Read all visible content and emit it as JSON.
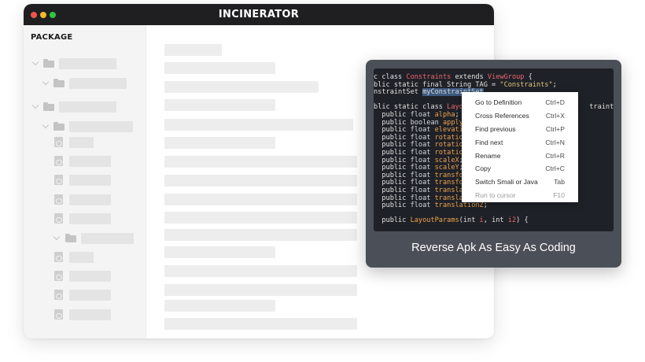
{
  "app": {
    "title": "INCINERATOR",
    "window_dots": [
      "#f0544c",
      "#f5b82d",
      "#2fc540"
    ]
  },
  "sidebar": {
    "heading": "PACKAGE"
  },
  "code": {
    "lines": [
      [
        {
          "t": "kw",
          "v": "c class "
        },
        {
          "t": "cls",
          "v": "Constraints"
        },
        {
          "t": "kw",
          "v": " extends "
        },
        {
          "t": "cls",
          "v": "ViewGroup"
        },
        {
          "t": "kw",
          "v": " {"
        }
      ],
      [
        {
          "t": "kw",
          "v": "blic static final String TAG = "
        },
        {
          "t": "str",
          "v": "\"Constraints\""
        },
        {
          "t": "kw",
          "v": ";"
        }
      ],
      [
        {
          "t": "kw",
          "v": "nstraintSet "
        },
        {
          "t": "hl",
          "v": "myConstraintSet"
        }
      ],
      [
        {
          "t": "kw",
          "v": ""
        }
      ],
      [
        {
          "t": "kw",
          "v": "blic static class "
        },
        {
          "t": "cls",
          "v": "Layou"
        },
        {
          "t": "kw",
          "v": "                              traintlay"
        }
      ],
      [
        {
          "t": "kw",
          "v": "  public "
        },
        {
          "t": "typ",
          "v": "float "
        },
        {
          "t": "fld",
          "v": "alpha"
        },
        {
          "t": "kw",
          "v": ";"
        }
      ],
      [
        {
          "t": "kw",
          "v": "  public "
        },
        {
          "t": "typ",
          "v": "boolean "
        },
        {
          "t": "fld",
          "v": "applyE"
        }
      ],
      [
        {
          "t": "kw",
          "v": "  public "
        },
        {
          "t": "typ",
          "v": "float "
        },
        {
          "t": "fld",
          "v": "elevati"
        }
      ],
      [
        {
          "t": "kw",
          "v": "  public "
        },
        {
          "t": "typ",
          "v": "float "
        },
        {
          "t": "fld",
          "v": "rotation"
        }
      ],
      [
        {
          "t": "kw",
          "v": "  public "
        },
        {
          "t": "typ",
          "v": "float "
        },
        {
          "t": "fld",
          "v": "rotatio"
        }
      ],
      [
        {
          "t": "kw",
          "v": "  public "
        },
        {
          "t": "typ",
          "v": "float "
        },
        {
          "t": "fld",
          "v": "rotatio"
        }
      ],
      [
        {
          "t": "kw",
          "v": "  public "
        },
        {
          "t": "typ",
          "v": "float "
        },
        {
          "t": "fld",
          "v": "scaleX"
        },
        {
          "t": "kw",
          "v": ";"
        }
      ],
      [
        {
          "t": "kw",
          "v": "  public "
        },
        {
          "t": "typ",
          "v": "float "
        },
        {
          "t": "fld",
          "v": "scaleY"
        },
        {
          "t": "kw",
          "v": ";"
        }
      ],
      [
        {
          "t": "kw",
          "v": "  public "
        },
        {
          "t": "typ",
          "v": "float "
        },
        {
          "t": "fld",
          "v": "transfor"
        }
      ],
      [
        {
          "t": "kw",
          "v": "  public "
        },
        {
          "t": "typ",
          "v": "float "
        },
        {
          "t": "fld",
          "v": "transfor"
        }
      ],
      [
        {
          "t": "kw",
          "v": "  public "
        },
        {
          "t": "typ",
          "v": "float "
        },
        {
          "t": "fld",
          "v": "transla"
        }
      ],
      [
        {
          "t": "kw",
          "v": "  public "
        },
        {
          "t": "typ",
          "v": "float "
        },
        {
          "t": "fld",
          "v": "translation"
        },
        {
          "t": "kw",
          "v": ";"
        }
      ],
      [
        {
          "t": "kw",
          "v": "  public "
        },
        {
          "t": "typ",
          "v": "float "
        },
        {
          "t": "fld",
          "v": "translationZ"
        },
        {
          "t": "kw",
          "v": ";"
        }
      ],
      [
        {
          "t": "kw",
          "v": ""
        }
      ],
      [
        {
          "t": "kw",
          "v": "  public "
        },
        {
          "t": "fld",
          "v": "LayoutParams"
        },
        {
          "t": "kw",
          "v": "(int "
        },
        {
          "t": "cls",
          "v": "i"
        },
        {
          "t": "kw",
          "v": ", int "
        },
        {
          "t": "cls",
          "v": "i2"
        },
        {
          "t": "kw",
          "v": ") {"
        }
      ]
    ]
  },
  "context_menu": {
    "items": [
      {
        "label": "Go to Definition",
        "shortcut": "Ctrl+D",
        "enabled": true
      },
      {
        "label": "Cross References",
        "shortcut": "Ctrl+X",
        "enabled": true
      },
      {
        "label": "Find previous",
        "shortcut": "Ctrl+P",
        "enabled": true
      },
      {
        "label": "Find next",
        "shortcut": "Ctrl+N",
        "enabled": true
      },
      {
        "label": "Rename",
        "shortcut": "Ctrl+R",
        "enabled": true
      },
      {
        "label": "Copy",
        "shortcut": "Ctrl+C",
        "enabled": true
      },
      {
        "label": "Switch Smali or Java",
        "shortcut": "Tab",
        "enabled": true
      },
      {
        "label": "Run to cursor",
        "shortcut": "F10",
        "enabled": false
      }
    ]
  },
  "promo": {
    "caption": "Reverse Apk As Easy As Coding"
  }
}
